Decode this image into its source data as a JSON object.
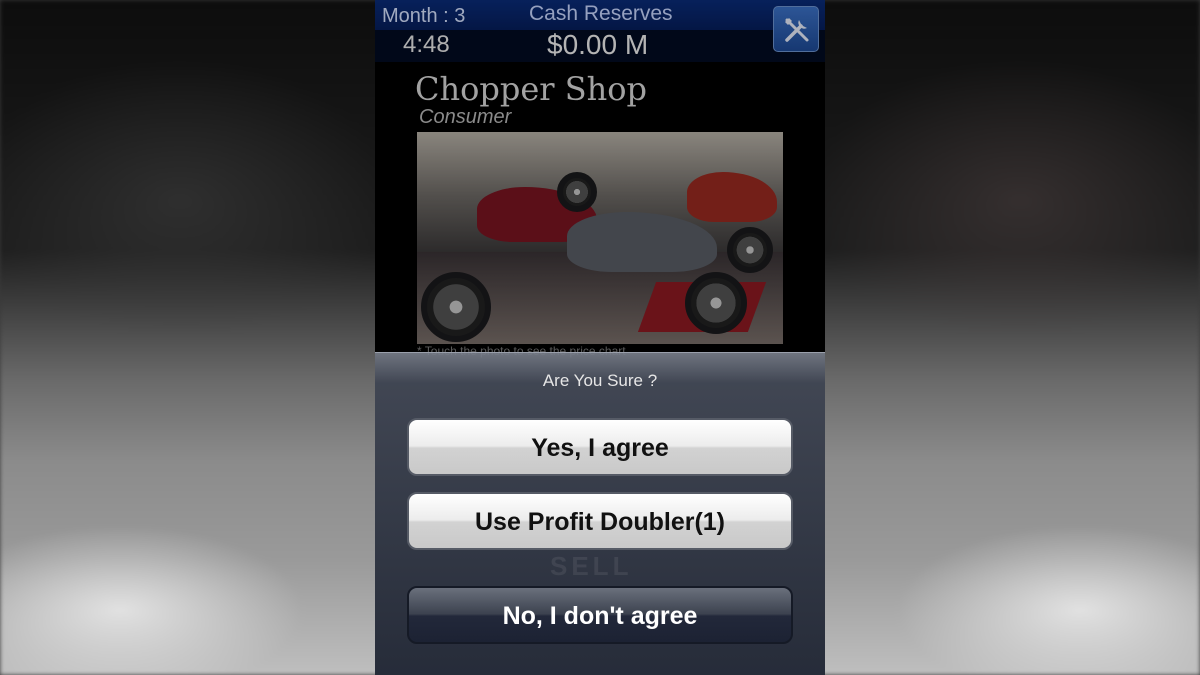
{
  "hud": {
    "month_label": "Month : 3",
    "time": "4:48",
    "cash_label": "Cash Reserves",
    "cash_value": "$0.00 M",
    "tools_icon": "tools-icon"
  },
  "shop": {
    "title": "Chopper Shop",
    "category": "Consumer",
    "photo_caption": "* Touch the photo to see the price chart"
  },
  "dialog": {
    "title": "Are You Sure ?",
    "yes_label": "Yes, I agree",
    "doubler_label": "Use Profit Doubler(1)",
    "no_label": "No, I don't agree",
    "behind_label": "SELL"
  },
  "colors": {
    "header_blue": "#0a2c7a",
    "tools_button": "#3c72c8",
    "sheet_background": "#464c5a",
    "cancel_button": "#22283a"
  }
}
